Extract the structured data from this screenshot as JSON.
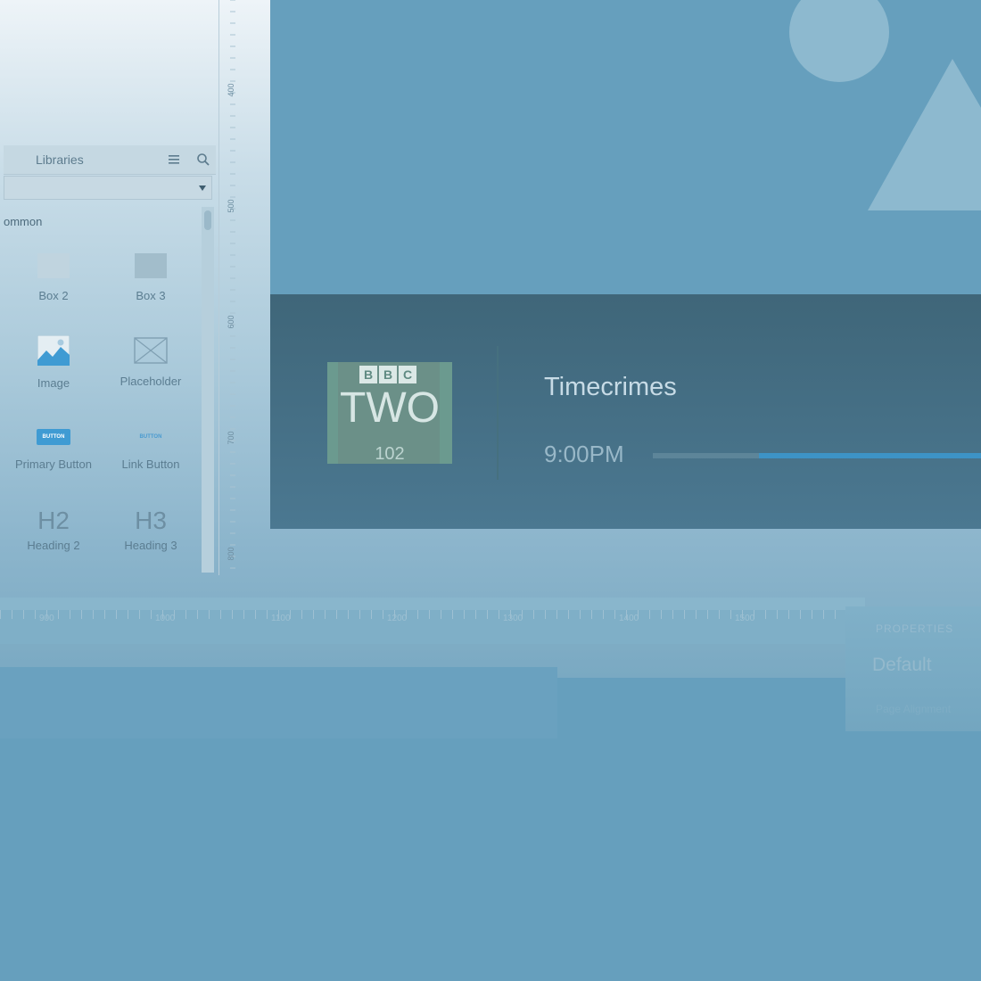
{
  "libraries": {
    "title": "Libraries",
    "section": "ommon",
    "dropdown_value": "",
    "widgets": [
      {
        "label": "Box 2",
        "icon": "box-icon"
      },
      {
        "label": "Box 3",
        "icon": "box-icon"
      },
      {
        "label": "Image",
        "icon": "image-icon"
      },
      {
        "label": "Placeholder",
        "icon": "placeholder-icon"
      },
      {
        "label": "Primary Button",
        "icon": "primary-button-icon",
        "glyph": "BUTTON"
      },
      {
        "label": "Link Button",
        "icon": "link-button-icon",
        "glyph": "BUTTON"
      },
      {
        "label": "Heading 2",
        "icon": "heading-icon",
        "glyph": "H2"
      },
      {
        "label": "Heading 3",
        "icon": "heading-icon",
        "glyph": "H3"
      }
    ]
  },
  "vertical_ruler": {
    "labels": [
      "400",
      "500",
      "600",
      "700",
      "800"
    ]
  },
  "horizontal_ruler": {
    "labels": [
      "900",
      "1000",
      "1100",
      "1200",
      "1300",
      "1400",
      "1500",
      "16"
    ]
  },
  "tv_guide": {
    "channel_brand": [
      "B",
      "B",
      "C"
    ],
    "channel_name": "TWO",
    "channel_number": "102",
    "program_title": "Timecrimes",
    "program_time": "9:00PM",
    "progress": 0.32
  },
  "properties": {
    "heading": "PROPERTIES",
    "value": "Default",
    "sub_label": "Page Alignment"
  },
  "colors": {
    "canvas": "#669fbd",
    "guide_panel": "#3f6679",
    "progress_accent": "#3d93c6",
    "channel_logo": "#6b9a8f"
  }
}
